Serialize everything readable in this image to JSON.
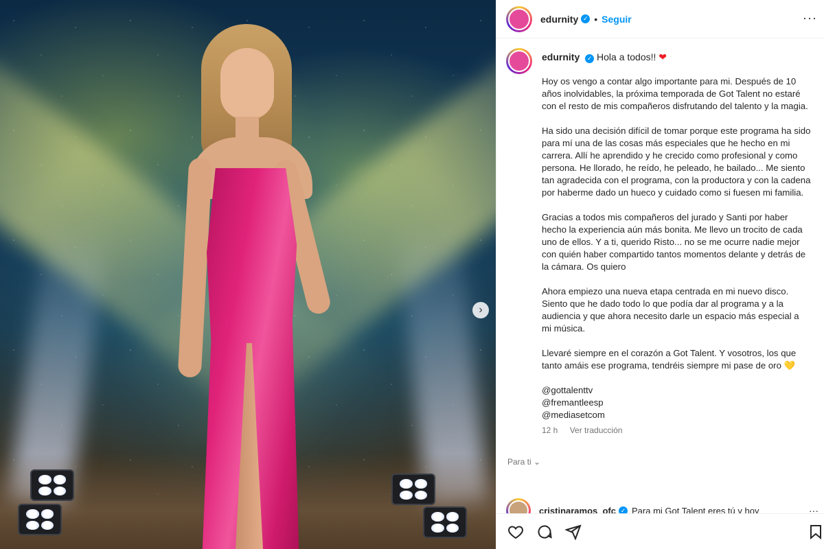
{
  "header": {
    "username": "edurnity",
    "verified_glyph": "✓",
    "separator": "•",
    "follow_label": "Seguir",
    "more_glyph": "···"
  },
  "caption": {
    "username": "edurnity",
    "greeting": "Hola a todos!!",
    "greeting_emoji": "❤",
    "paragraphs": [
      "Hoy os vengo a contar algo importante para mi. Después de 10 años inolvidables, la próxima temporada de Got Talent no estaré con el resto de mis compañeros disfrutando del talento y la magia.",
      "Ha sido una decisión difícil de tomar porque este programa ha sido para mí una de las cosas más especiales que he hecho en mi carrera. Allí he aprendido y he crecido como profesional y como persona. He llorado, he reído, he peleado, he bailado... Me siento tan agradecida con el programa, con la productora y con la cadena por haberme dado un hueco y cuidado como si fuesen mi familia.",
      "Gracias a todos mis compañeros del jurado y Santi por haber hecho la experiencia aún más bonita. Me llevo un trocito de cada uno de ellos. Y a ti, querido Risto... no se me ocurre nadie mejor con quién haber compartido tantos momentos delante y detrás de la cámara. Os quiero",
      "Ahora empiezo una nueva etapa centrada en mi nuevo disco. Siento que he dado todo lo que podía dar al programa y a la audiencia y que ahora necesito darle un espacio más especial a mi música."
    ],
    "last_paragraph": "Llevaré siempre en el corazón a Got Talent. Y vosotros, los que tanto amáis ese programa, tendréis siempre mi pase de oro",
    "last_emoji": "💛",
    "mentions": [
      "@gottalenttv",
      "@fremantleesp",
      "@mediasetcom"
    ],
    "time_ago": "12 h",
    "translate_label": "Ver traducción"
  },
  "for_you_label": "Para ti ⌄",
  "comment": {
    "username": "cristinaramos_ofc",
    "text": "Para mi Got Talent eres tú y hoy",
    "more_glyph": "···"
  },
  "media": {
    "next_glyph": "›"
  },
  "colors": {
    "accent": "#0095f6",
    "dress": "#e0237a",
    "text": "#262626",
    "muted": "#737373"
  },
  "icons": [
    "heart-icon",
    "comment-icon",
    "share-icon",
    "bookmark-icon",
    "verified-icon",
    "chevron-right-icon"
  ]
}
